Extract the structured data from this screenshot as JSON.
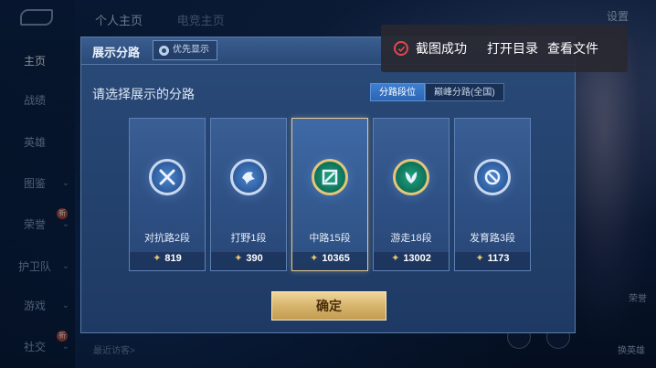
{
  "background": {
    "sidebar": [
      {
        "label": "主页",
        "active": true,
        "chevron": false,
        "new": false
      },
      {
        "label": "战绩",
        "active": false,
        "chevron": false,
        "new": false
      },
      {
        "label": "英雄",
        "active": false,
        "chevron": false,
        "new": false
      },
      {
        "label": "图鉴",
        "active": false,
        "chevron": true,
        "new": false
      },
      {
        "label": "荣誉",
        "active": false,
        "chevron": true,
        "new": true
      },
      {
        "label": "护卫队",
        "active": false,
        "chevron": true,
        "new": false
      },
      {
        "label": "游戏",
        "active": false,
        "chevron": true,
        "new": false
      },
      {
        "label": "社交",
        "active": false,
        "chevron": true,
        "new": true
      }
    ],
    "new_badge": "新",
    "top_tabs": [
      "个人主页",
      "电竞主页"
    ],
    "settings": "设置",
    "recent_visitors": "最近访客>",
    "side_button_1": "荣誉",
    "side_button_2": "换英雄"
  },
  "dialog": {
    "title": "展示分路",
    "priority_button": "优先显示",
    "prompt": "请选择展示的分路",
    "tabs": [
      {
        "label": "分路段位",
        "active": true
      },
      {
        "label": "巅峰分路(全国)",
        "active": false
      }
    ],
    "cards": [
      {
        "name": "对抗路2段",
        "score": "819",
        "selected": false,
        "icon": "crossed-swords-icon"
      },
      {
        "name": "打野1段",
        "score": "390",
        "selected": false,
        "icon": "dragon-icon"
      },
      {
        "name": "中路15段",
        "score": "10365",
        "selected": true,
        "icon": "mid-lane-icon"
      },
      {
        "name": "游走18段",
        "score": "13002",
        "selected": false,
        "icon": "support-leaf-icon"
      },
      {
        "name": "发育路3段",
        "score": "1173",
        "selected": false,
        "icon": "marksman-icon"
      }
    ],
    "confirm": "确定"
  },
  "toast": {
    "message": "截图成功",
    "action_open_dir": "打开目录",
    "action_view_file": "查看文件"
  },
  "colors": {
    "accent_blue": "#3f7fd0",
    "gold": "#d6b46c",
    "selected_border": "#e2c994",
    "toast_check": "#e04a4a"
  }
}
